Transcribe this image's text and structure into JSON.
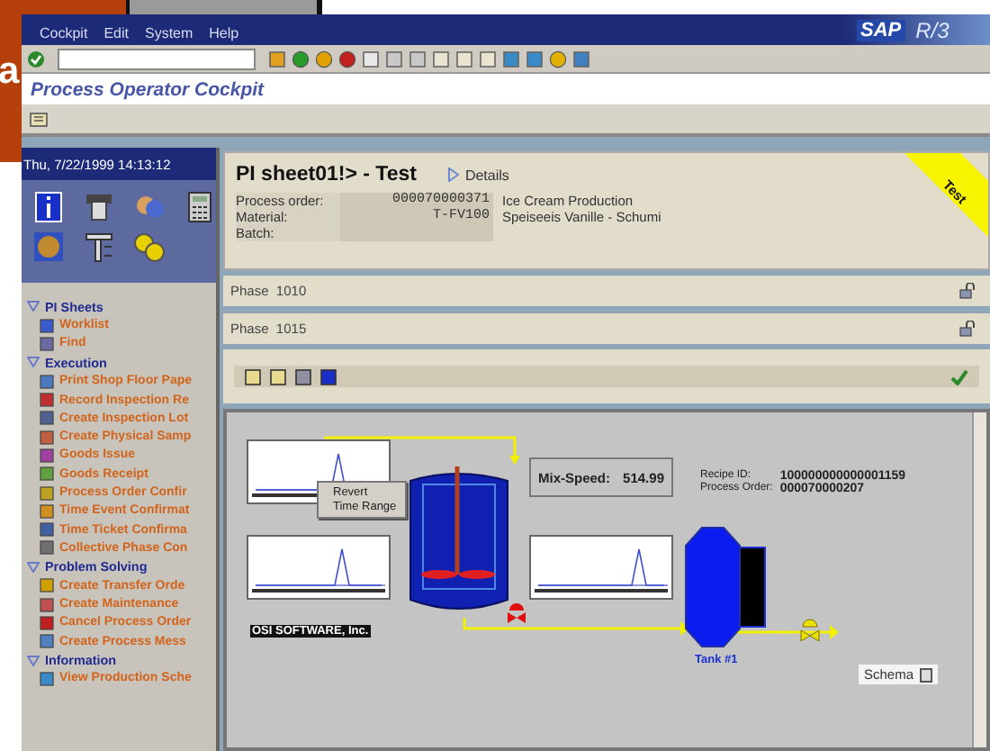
{
  "backdrop": {
    "letter": "a"
  },
  "window": {
    "menu": [
      "Cockpit",
      "Edit",
      "System",
      "Help"
    ],
    "title": "Process Operator Cockpit",
    "brand": "SAP",
    "brand_suffix": "R/3"
  },
  "clock": "Thu, 7/22/1999  14:13:12",
  "navigation": [
    {
      "label": "PI Sheets",
      "expanded": true,
      "children": [
        {
          "label": "Worklist"
        },
        {
          "label": "Find"
        }
      ]
    },
    {
      "label": "Execution",
      "expanded": true,
      "children": [
        {
          "label": "Print Shop Floor Pape"
        },
        {
          "label": "Record Inspection Re"
        },
        {
          "label": "Create Inspection Lot"
        },
        {
          "label": "Create Physical Samp"
        },
        {
          "label": "Goods Issue"
        },
        {
          "label": "Goods Receipt"
        },
        {
          "label": "Process Order Confir"
        },
        {
          "label": "Time Event Confirmat"
        },
        {
          "label": "Time Ticket Confirma"
        },
        {
          "label": "Collective Phase Con"
        }
      ]
    },
    {
      "label": "Problem Solving",
      "expanded": true,
      "children": [
        {
          "label": "Create Transfer Orde"
        },
        {
          "label": "Create Maintenance"
        },
        {
          "label": "Cancel Process Order"
        },
        {
          "label": "Create Process Mess"
        }
      ]
    },
    {
      "label": "Information",
      "expanded": true,
      "children": [
        {
          "label": "View Production Sche"
        }
      ]
    }
  ],
  "sheet": {
    "title": "PI sheet01!> - Test",
    "details": "Details",
    "badge": "Test",
    "fields": [
      {
        "label": "Process order:",
        "value": "000070000371",
        "description": "Ice Cream Production"
      },
      {
        "label": "Material:",
        "value": "T-FV100",
        "description": "Speiseeis Vanille - Schumi"
      },
      {
        "label": "Batch:"
      }
    ]
  },
  "phases": [
    "Phase  1010",
    "Phase  1015"
  ],
  "diagram": {
    "context_menu": [
      "Revert",
      "Time Range"
    ],
    "vendor": "OSI SOFTWARE, Inc.",
    "mix_label": "Mix-Speed:",
    "mix_value": "514.99",
    "recipe": [
      {
        "label": "Recipe ID:",
        "value": "100000000000001159"
      },
      {
        "label": "Process Order:",
        "value": "000070000207"
      }
    ],
    "tank": "Tank #1",
    "schema_button": "Schema"
  }
}
